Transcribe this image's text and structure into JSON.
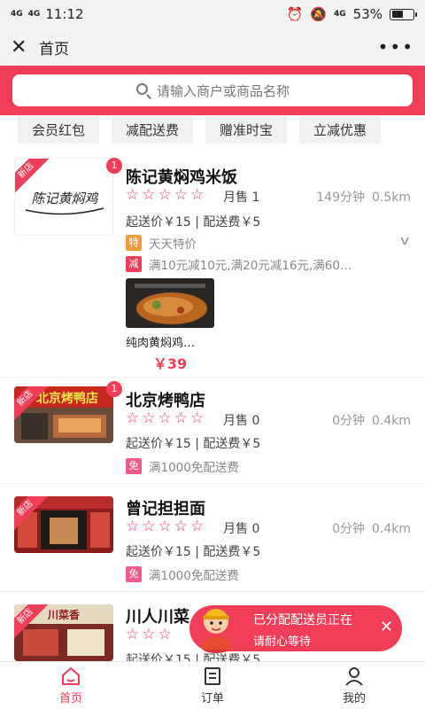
{
  "status_bar": {
    "signal_left": "4G",
    "signal_left2": "4G",
    "time": "11:12",
    "signal_right": "4G",
    "battery_text": "53%",
    "battery_level": 0.53
  },
  "title_bar": {
    "title": "首页"
  },
  "search": {
    "placeholder": "请输入商户或商品名称"
  },
  "chips": [
    "会员红包",
    "减配送费",
    "赠准时宝",
    "立减优惠"
  ],
  "shops": [
    {
      "name": "陈记黄焖鸡米饭",
      "badge": "1",
      "new_label": "新店",
      "sold": "月售 1",
      "time": "149分钟",
      "distance": "0.5km",
      "fees": "起送价￥15 | 配送费￥5",
      "promo_special_tag": "特",
      "promo_special": "天天特价",
      "promo_discount_tag": "减",
      "promo_discount": "满10元减10元,满20元减16元,满60…",
      "dish_name": "纯肉黄焖鸡…",
      "dish_price": "￥39",
      "logo_text": "陈记黄焖鸡"
    },
    {
      "name": "北京烤鸭店",
      "badge": "1",
      "new_label": "新店",
      "sold": "月售 0",
      "time": "0分钟",
      "distance": "0.4km",
      "fees": "起送价￥15 | 配送费￥5",
      "promo_tag": "免",
      "promo": "满1000免配送费",
      "logo_text": "北京烤鸭店"
    },
    {
      "name": "曾记担担面",
      "new_label": "新店",
      "sold": "月售 0",
      "time": "0分钟",
      "distance": "0.4km",
      "fees": "起送价￥15 | 配送费￥5",
      "promo_tag": "免",
      "promo": "满1000免配送费"
    },
    {
      "name": "川人川菜",
      "new_label": "新店",
      "fees": "起送价￥15 | 配送费￥5",
      "logo_text": "川菜香"
    }
  ],
  "toast": {
    "line1": "已分配配送员正在",
    "line2": "请耐心等待"
  },
  "tabs": [
    {
      "label": "首页",
      "icon": "home-icon",
      "active": true
    },
    {
      "label": "订单",
      "icon": "order-icon",
      "active": false
    },
    {
      "label": "我的",
      "icon": "profile-icon",
      "active": false
    }
  ],
  "colors": {
    "accent": "#f03e58",
    "special_tag": "#f39b3b"
  }
}
